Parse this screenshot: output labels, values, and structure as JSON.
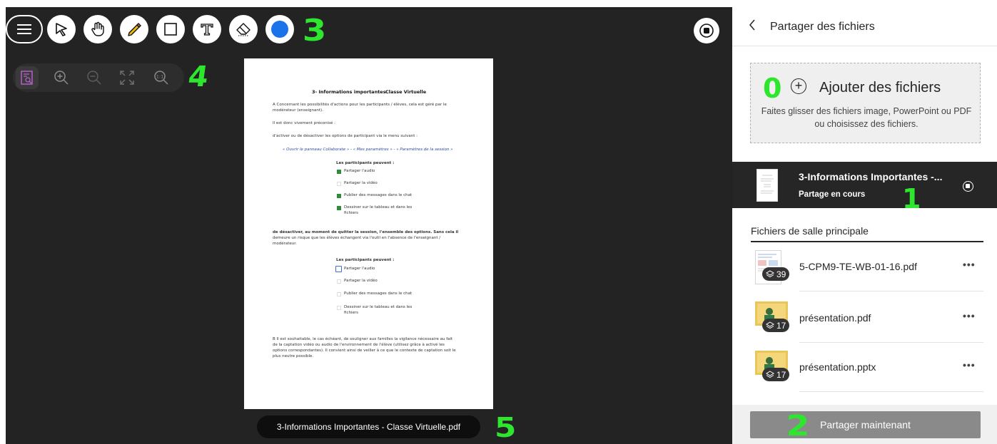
{
  "toolbar": {
    "menu": "menu-icon",
    "tools": [
      "select-cursor-icon",
      "hand-pan-icon",
      "pencil-icon",
      "rectangle-icon",
      "text-icon",
      "eraser-icon",
      "color-picker-icon"
    ],
    "active_color": "#1a73e8",
    "stop_share": "stop-share-icon"
  },
  "zoom_tools": [
    "page-search-icon",
    "zoom-in-icon",
    "zoom-out-icon",
    "fit-screen-icon",
    "actual-size-icon"
  ],
  "annotations": {
    "a0": "0",
    "a1": "1",
    "a2": "2",
    "a3": "3",
    "a4": "4",
    "a5": "5"
  },
  "document": {
    "title_left": "3- Informations importantes",
    "title_right": "Classe Virtuelle",
    "para_a": [
      "A  Concernant les possibilités d'actions pour les participants / élèves, cela est géré par le",
      "modérateur (enseignant).",
      "",
      "Il est donc vivement préconisé :",
      "",
      "  d'activer ou de désactiver les options de participant via le menu suivant :"
    ],
    "path": "« Ouvrir le panneau Collaborate » - « Mes paramètres » - « Paramètres de la session »",
    "list1_title": "Les participants peuvent :",
    "list1": [
      "Partager l'audio",
      "Partager la vidéo",
      "Publier des messages dans le chat",
      "Dessiner sur le tableau et dans les",
      "fichiers"
    ],
    "para_b": [
      "  de désactiver, au moment de quitter la session, l'ensemble des options. Sans cela il",
      "demeure un risque que les élèves échangent via l'outil en l'absence de l'enseignant /",
      "modérateur."
    ],
    "list2_title": "Les participants peuvent :",
    "list2": [
      "Partager l'audio",
      "Partager la vidéo",
      "Publier des messages dans le chat",
      "Dessiner sur le tableau et dans les",
      "fichiers"
    ],
    "para_c": [
      "B  Il est souhaitable, le cas échéant, de souligner aux familles la vigilance nécessaire au fait",
      "de la captation vidéo ou audio de l'environnement de l'élève (utilisez grâce à activé les",
      "options correspondantes). Il convient ainsi de veiller à ce que le contexte de captation soit le",
      "plus neutre possible."
    ]
  },
  "doc_filename": "3-Informations Importantes - Classe Virtuelle.pdf",
  "panel": {
    "back_icon": "chevron-left-icon",
    "title": "Partager des fichiers",
    "upload_title": "Ajouter des fichiers",
    "upload_hint": "Faites glisser des fichiers image, PowerPoint ou PDF ou choisissez des fichiers.",
    "sharing_name": "3-Informations Importantes -...",
    "sharing_status": "Partage en cours",
    "section_title": "Fichiers de salle principale",
    "files": [
      {
        "name": "5-CPM9-TE-WB-01-16.pdf",
        "count": "39",
        "more": "•••"
      },
      {
        "name": "présentation.pdf",
        "count": "17",
        "more": "•••"
      },
      {
        "name": "présentation.pptx",
        "count": "17",
        "more": "•••"
      }
    ],
    "share_button": "Partager maintenant"
  }
}
